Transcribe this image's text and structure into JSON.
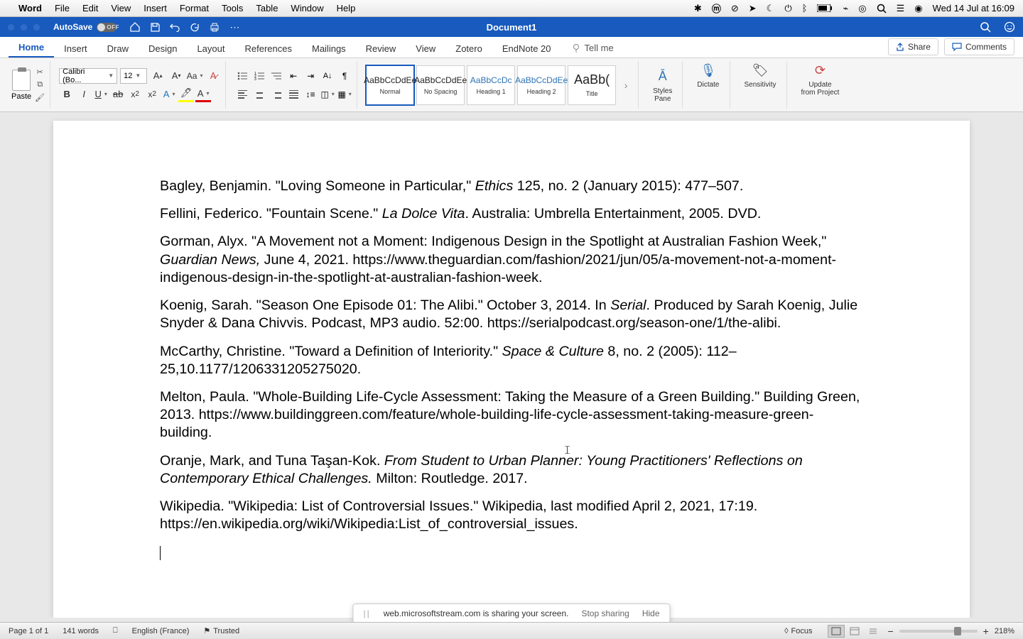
{
  "mac_menu": {
    "app": "Word",
    "items": [
      "File",
      "Edit",
      "View",
      "Insert",
      "Format",
      "Tools",
      "Table",
      "Window",
      "Help"
    ],
    "clock": "Wed 14 Jul at  16:09"
  },
  "title_bar": {
    "autosave_label": "AutoSave",
    "autosave_state": "OFF",
    "doc_title": "Document1"
  },
  "ribbon": {
    "tabs": [
      "Home",
      "Insert",
      "Draw",
      "Design",
      "Layout",
      "References",
      "Mailings",
      "Review",
      "View",
      "Zotero",
      "EndNote 20"
    ],
    "active_tab": "Home",
    "tell_me": "Tell me",
    "share": "Share",
    "comments": "Comments",
    "paste_label": "Paste",
    "font_name": "Calibri (Bo...",
    "font_size": "12",
    "styles": [
      {
        "preview": "AaBbCcDdEe",
        "label": "Normal",
        "active": true,
        "cls": ""
      },
      {
        "preview": "AaBbCcDdEe",
        "label": "No Spacing",
        "active": false,
        "cls": ""
      },
      {
        "preview": "AaBbCcDc",
        "label": "Heading 1",
        "active": false,
        "cls": "h1"
      },
      {
        "preview": "AaBbCcDdEe",
        "label": "Heading 2",
        "active": false,
        "cls": "h2"
      },
      {
        "preview": "AaBb(",
        "label": "Title",
        "active": false,
        "cls": "title"
      }
    ],
    "panes": {
      "styles_pane": "Styles\nPane",
      "dictate": "Dictate",
      "sensitivity": "Sensitivity",
      "update": "Update\nfrom Project"
    }
  },
  "document": {
    "paragraphs": [
      {
        "html": "Bagley, Benjamin. \"Loving Someone in Particular,\" <em>Ethics</em> 125, no. 2 (January 2015): 477–507."
      },
      {
        "html": "Fellini, Federico. \"Fountain Scene.\" <em>La Dolce Vita</em>. Australia: Umbrella Entertainment, 2005. DVD."
      },
      {
        "html": "Gorman, Alyx. \"A Movement not a Moment: Indigenous Design in the Spotlight at Australian Fashion Week,\" <em>Guardian News,</em> June 4, 2021. https://www.theguardian.com/fashion/2021/jun/05/a-movement-not-a-moment-indigenous-design-in-the-spotlight-at-australian-fashion-week."
      },
      {
        "html": "Koenig, Sarah. \"Season One Episode 01: The Alibi.\" October 3, 2014. In <em>Serial</em>. Produced by Sarah Koenig, Julie Snyder & Dana Chivvis. Podcast, MP3 audio. 52:00. https://serialpodcast.org/season-one/1/the-alibi."
      },
      {
        "html": "McCarthy, Christine.  \"Toward a Definition of Interiority.\" <em>Space & Culture</em> 8, no. 2 (2005): 112–25,10.1177/1206331205275020."
      },
      {
        "html": "Melton, Paula. \"Whole-Building Life-Cycle Assessment: Taking the Measure of a Green Building.\" Building Green, 2013. https://www.buildinggreen.com/feature/whole-building-life-cycle-assessment-taking-measure-green-building."
      },
      {
        "html": "Oranje, Mark, and Tuna Taşan-Kok. <em>From Student to Urban Planner: Young Practitioners' Reflections on Contemporary Ethical Challenges.</em> Milton: Routledge. 2017."
      },
      {
        "html": "Wikipedia. \"Wikipedia: List of Controversial Issues.\" Wikipedia, last modified April 2, 2021, 17:19. https://en.wikipedia.org/wiki/Wikipedia:List_of_controversial_issues."
      }
    ]
  },
  "share_bar": {
    "msg": "web.microsoftstream.com is sharing your screen.",
    "stop": "Stop sharing",
    "hide": "Hide"
  },
  "status_bar": {
    "page": "Page 1 of 1",
    "words": "141 words",
    "lang": "English (France)",
    "trusted": "Trusted",
    "focus": "Focus",
    "zoom": "218%"
  }
}
